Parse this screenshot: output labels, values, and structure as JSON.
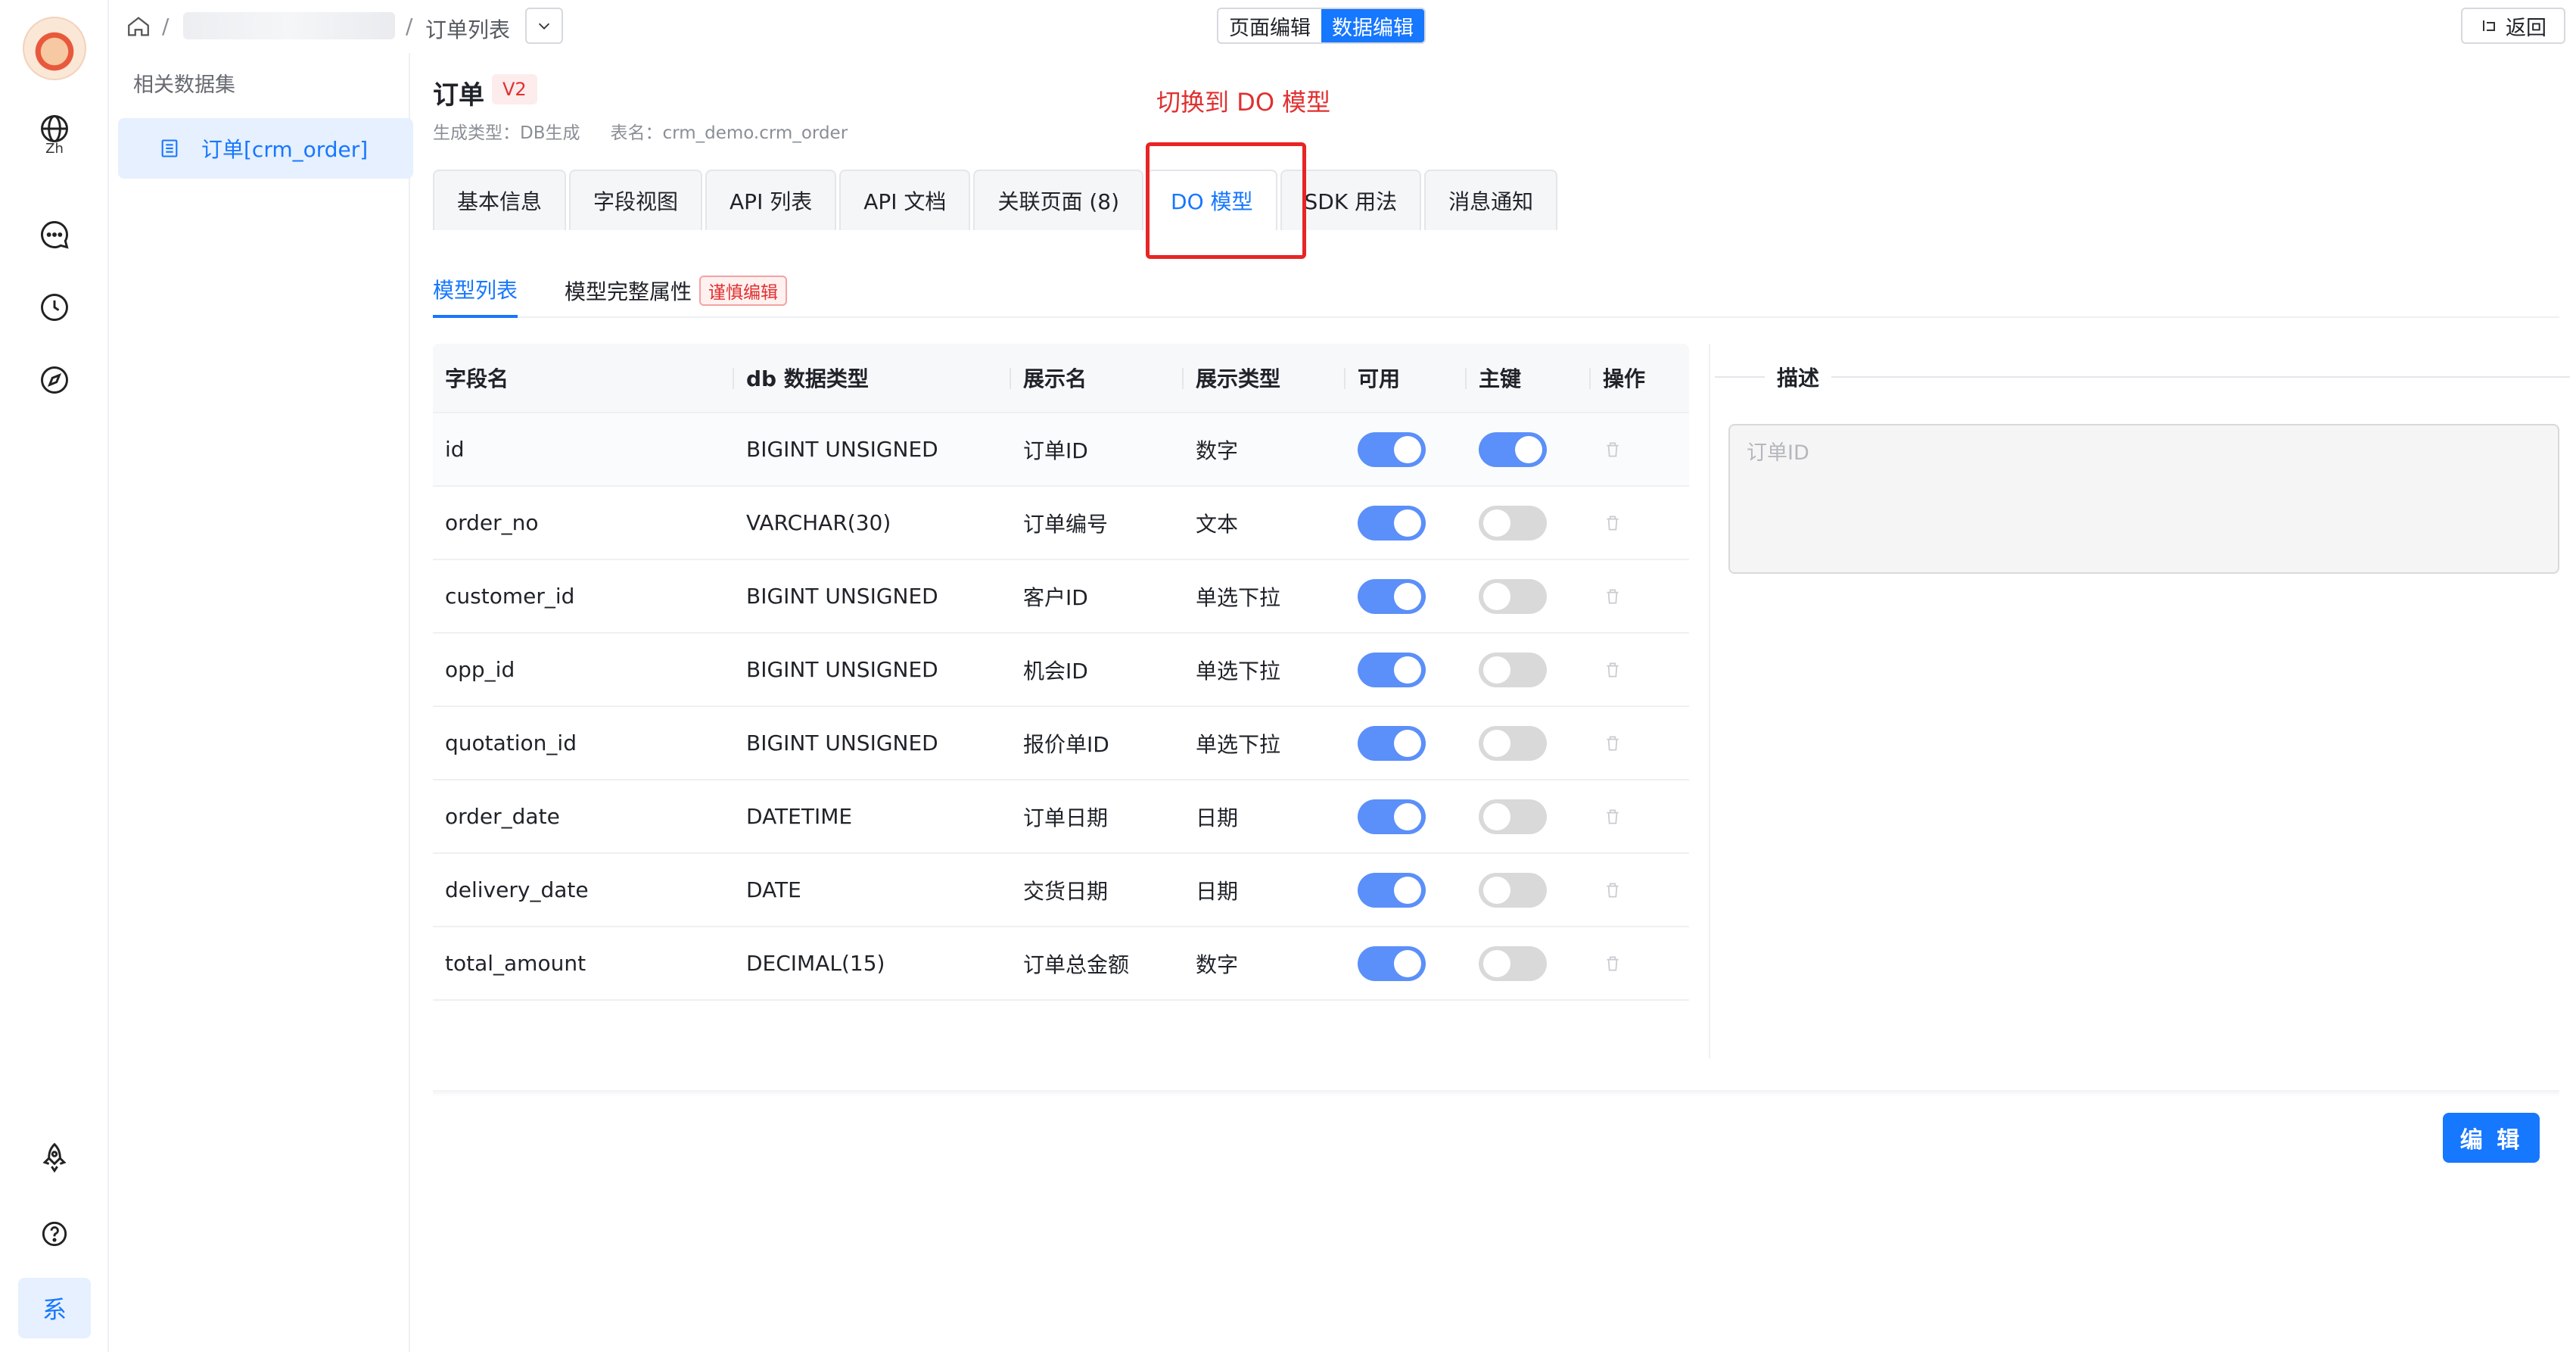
{
  "nav": {
    "lang_label": "Zh",
    "sys_label": "系"
  },
  "breadcrumb": {
    "separator": "/",
    "current": "订单列表"
  },
  "mode_switch": {
    "page_edit": "页面编辑",
    "data_edit": "数据编辑",
    "active": "数据编辑"
  },
  "back_label": "返回",
  "dataset_panel": {
    "title": "相关数据集",
    "item": "订单[crm_order]"
  },
  "header": {
    "title": "订单",
    "version": "V2",
    "gen_type": "生成类型：DB生成",
    "table_name": "表名：crm_demo.crm_order",
    "annotation": "切换到 DO 模型"
  },
  "tabs": [
    "基本信息",
    "字段视图",
    "API 列表",
    "API 文档",
    "关联页面 (8)",
    "DO 模型",
    "SDK 用法",
    "消息通知"
  ],
  "active_tab": "DO 模型",
  "subtabs": {
    "model_list": "模型列表",
    "full_props": "模型完整属性",
    "caution_tag": "谨慎编辑"
  },
  "table": {
    "columns": [
      "字段名",
      "db 数据类型",
      "展示名",
      "展示类型",
      "可用",
      "主键",
      "操作"
    ],
    "rows": [
      {
        "field": "id",
        "db_type": "BIGINT UNSIGNED",
        "display_name": "订单ID",
        "display_type": "数字",
        "enabled": true,
        "primary_key": true
      },
      {
        "field": "order_no",
        "db_type": "VARCHAR(30)",
        "display_name": "订单编号",
        "display_type": "文本",
        "enabled": true,
        "primary_key": false
      },
      {
        "field": "customer_id",
        "db_type": "BIGINT UNSIGNED",
        "display_name": "客户ID",
        "display_type": "单选下拉",
        "enabled": true,
        "primary_key": false
      },
      {
        "field": "opp_id",
        "db_type": "BIGINT UNSIGNED",
        "display_name": "机会ID",
        "display_type": "单选下拉",
        "enabled": true,
        "primary_key": false
      },
      {
        "field": "quotation_id",
        "db_type": "BIGINT UNSIGNED",
        "display_name": "报价单ID",
        "display_type": "单选下拉",
        "enabled": true,
        "primary_key": false
      },
      {
        "field": "order_date",
        "db_type": "DATETIME",
        "display_name": "订单日期",
        "display_type": "日期",
        "enabled": true,
        "primary_key": false
      },
      {
        "field": "delivery_date",
        "db_type": "DATE",
        "display_name": "交货日期",
        "display_type": "日期",
        "enabled": true,
        "primary_key": false
      },
      {
        "field": "total_amount",
        "db_type": "DECIMAL(15)",
        "display_name": "订单总金额",
        "display_type": "数字",
        "enabled": true,
        "primary_key": false
      }
    ]
  },
  "description": {
    "label": "描述",
    "value": "订单ID"
  },
  "edit_label": "编 辑",
  "colors": {
    "accent": "#1677ff",
    "switch_on": "#5b8ff9",
    "switch_off": "#d9d9d9",
    "annotation_red": "#e82424"
  },
  "icons": [
    "home-icon",
    "chevron-down-icon",
    "back-icon",
    "globe-icon",
    "chat-icon",
    "clock-icon",
    "compass-icon",
    "rocket-icon",
    "help-icon",
    "table-icon",
    "trash-icon"
  ]
}
